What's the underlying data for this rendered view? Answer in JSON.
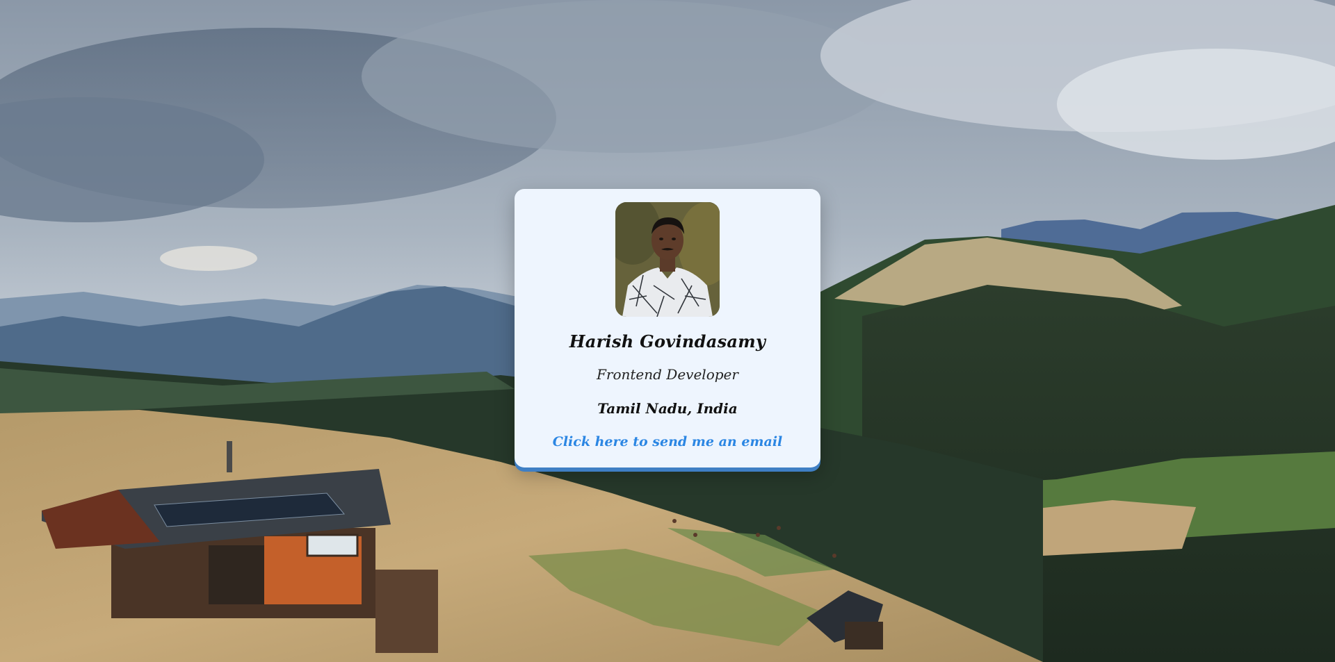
{
  "profile": {
    "name": "Harish Govindasamy",
    "role": "Frontend Developer",
    "location": "Tamil Nadu, India",
    "email_link_text": "Click here to send me an email"
  },
  "colors": {
    "card_background": "#eef5fe",
    "card_border_accent": "#3f7fc4",
    "link": "#2b86e3",
    "text": "#111111"
  },
  "images": {
    "background": "mountain-landscape-with-cabin",
    "avatar": "profile-photo"
  }
}
